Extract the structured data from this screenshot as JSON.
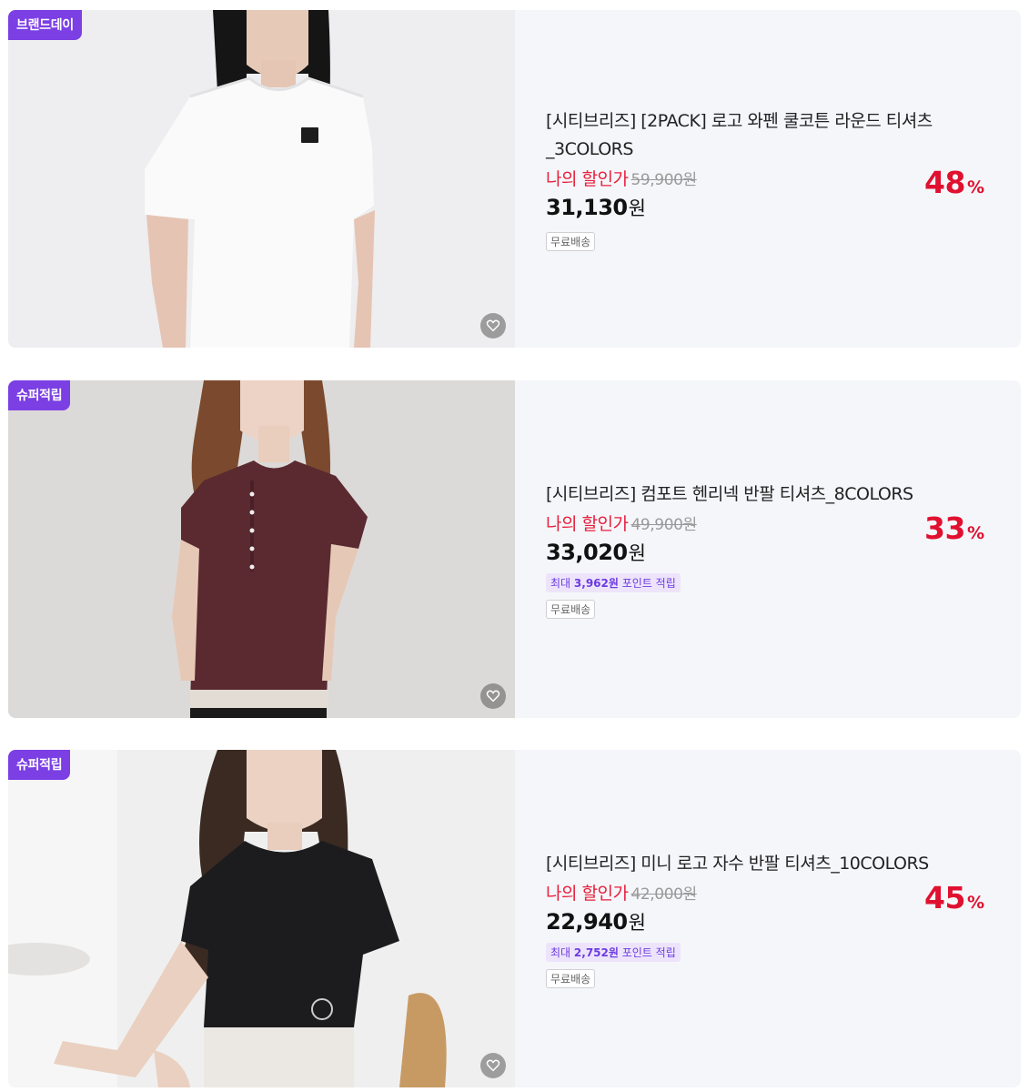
{
  "products": [
    {
      "badge": "브랜드데이",
      "title": "[시티브리즈] [2PACK] 로고 와펜 쿨코튼 라운드 티셔츠_3COLORS",
      "my_price_label": "나의 할인가",
      "original_price": "59,900원",
      "sale_price": "31,130",
      "sale_unit": "원",
      "discount": "48",
      "discount_unit": "%",
      "point_text": null,
      "shipping": "무료배송",
      "shirt_color": "#f3f3f5"
    },
    {
      "badge": "슈퍼적립",
      "title": "[시티브리즈] 컴포트 헨리넥 반팔 티셔츠_8COLORS",
      "my_price_label": "나의 할인가",
      "original_price": "49,900원",
      "sale_price": "33,020",
      "sale_unit": "원",
      "discount": "33",
      "discount_unit": "%",
      "point_prefix": "최대 ",
      "point_amount": "3,962원",
      "point_suffix": " 포인트 적립",
      "shipping": "무료배송",
      "shirt_color": "#5a2a30"
    },
    {
      "badge": "슈퍼적립",
      "title": "[시티브리즈] 미니 로고 자수 반팔 티셔츠_10COLORS",
      "my_price_label": "나의 할인가",
      "original_price": "42,000원",
      "sale_price": "22,940",
      "sale_unit": "원",
      "discount": "45",
      "discount_unit": "%",
      "point_prefix": "최대 ",
      "point_amount": "2,752원",
      "point_suffix": " 포인트 적립",
      "shipping": "무료배송",
      "shirt_color": "#1c1c1e"
    }
  ],
  "colors": {
    "badge_purple": "#7b3fe4",
    "discount_red": "#e0102f",
    "my_price_red": "#e8203c",
    "card_bg": "#f5f6fa"
  },
  "icons": {
    "wishlist": "heart-outline-icon"
  }
}
